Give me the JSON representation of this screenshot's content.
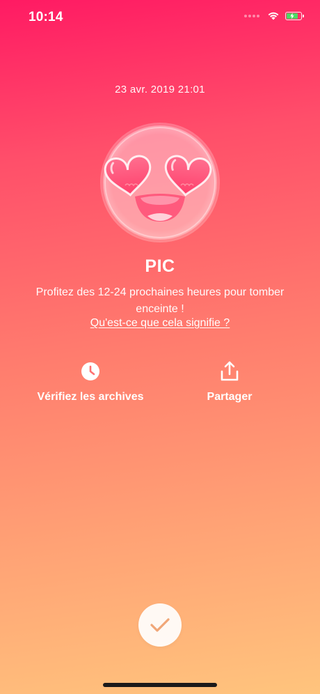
{
  "status_bar": {
    "time": "10:14",
    "battery_level": 0.8,
    "battery_color": "#4cd964",
    "icons": [
      "signal-dots-icon",
      "wifi-icon",
      "battery-charging-icon"
    ]
  },
  "result": {
    "date": "23 avr. 2019 21:01",
    "emoji": "heart-eyes-emoji",
    "title": "PIC",
    "description": "Profitez des 12-24 prochaines heures pour tomber enceinte !",
    "link": "Qu'est-ce que cela signifie ?"
  },
  "actions": {
    "archives": {
      "label": "Vérifiez les archives",
      "icon": "clock-icon"
    },
    "share": {
      "label": "Partager",
      "icon": "share-icon"
    }
  },
  "confirm": {
    "icon": "checkmark-icon"
  },
  "colors": {
    "gradient_top": "#ff1a63",
    "gradient_bottom": "#ffc47d",
    "checkmark": "#f0a677"
  }
}
